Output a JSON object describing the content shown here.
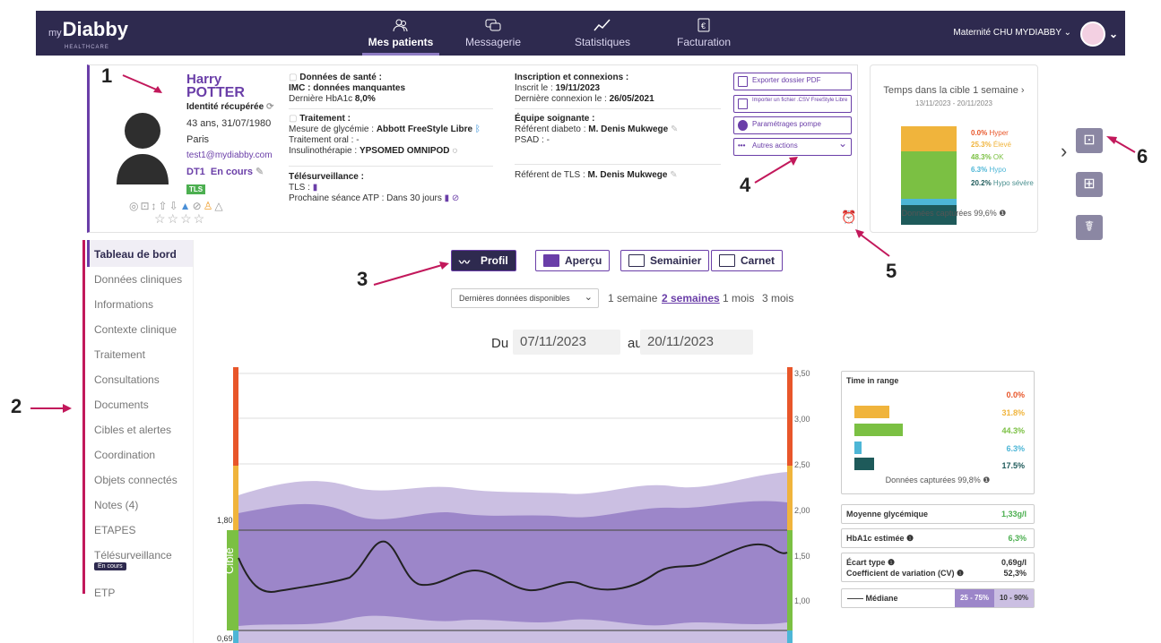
{
  "app": {
    "logo_prefix": "my",
    "logo": "Diabby",
    "logo_sub": "HEALTHCARE"
  },
  "nav": [
    {
      "label": "Mes patients",
      "icon": "patients-icon",
      "active": true
    },
    {
      "label": "Messagerie",
      "icon": "chat-icon"
    },
    {
      "label": "Statistiques",
      "icon": "stats-icon"
    },
    {
      "label": "Facturation",
      "icon": "billing-icon"
    }
  ],
  "establishment": "Maternité CHU MYDIABBY",
  "patient": {
    "first_name": "Harry",
    "last_name": "POTTER",
    "identity": "Identité récupérée",
    "age_dob": "43 ans, 31/07/1980",
    "city": "Paris",
    "email": "test1@mydiabby.com",
    "diabetes_type": "DT1",
    "status": "En cours",
    "tls_badge": "TLS"
  },
  "health": {
    "title": "Données de santé :",
    "line1": "IMC : données manquantes",
    "line2_label": "Dernière HbA1c ",
    "line2_value": "8,0%",
    "treatment_title": "Traitement :",
    "t1_label": "Mesure de glycémie : ",
    "t1_value": "Abbott FreeStyle Libre",
    "t2": "Traitement oral : -",
    "t3_label": "Insulinothérapie : ",
    "t3_value": "YPSOMED OMNIPOD",
    "telesurv_title": "Télésurveillance :",
    "telesurv_tls": "TLS :",
    "telesurv_next": "Prochaine séance ATP : Dans 30 jours"
  },
  "inscription": {
    "title": "Inscription et connexions :",
    "l1_label": "Inscrit le : ",
    "l1_value": "19/11/2023",
    "l2_label": "Dernière connexion le : ",
    "l2_value": "26/05/2021",
    "team_title": "Équipe soignante :",
    "team1_label": "Référent diabeto : ",
    "team1_value": "M. Denis Mukwege",
    "team2": "PSAD : -",
    "tls_ref_label": "Référent de TLS : ",
    "tls_ref_value": "M. Denis Mukwege"
  },
  "actions": {
    "export": "Exporter dossier PDF",
    "import": "Importer un fichier .CSV FreeStyle Libre",
    "pump": "Paramétrages pompe",
    "more": "Autres actions"
  },
  "tir_summary": {
    "title": "Temps dans la cible 1 semaine",
    "dates": "13/11/2023 - 20/11/2023",
    "rows": [
      {
        "value": "0.0%",
        "label": "Hyper",
        "color": "#e8562a",
        "frac": 0.0
      },
      {
        "value": "25.3%",
        "label": "Élevé",
        "color": "#f0b43c",
        "frac": 0.253
      },
      {
        "value": "48.3%",
        "label": "OK",
        "color": "#7bc043",
        "frac": 0.483
      },
      {
        "value": "6.3%",
        "label": "Hypo",
        "color": "#4db6d6",
        "frac": 0.063
      },
      {
        "value": "20.2%",
        "label": "Hypo sévère",
        "color": "#1e5a5a",
        "frac": 0.202
      }
    ],
    "captured": "Données capturées 99,6%"
  },
  "leftnav": [
    "Tableau de bord",
    "Données cliniques",
    "Informations",
    "Contexte clinique",
    "Traitement",
    "Consultations",
    "Documents",
    "Cibles et alertes",
    "Coordination",
    "Objets connectés",
    "Notes (4)",
    "ETAPES",
    "Télésurveillance",
    "ETP"
  ],
  "leftnav_badge": "En cours",
  "views": [
    "Profil",
    "Aperçu",
    "Semainier",
    "Carnet"
  ],
  "period": {
    "select": "Dernières données disponibles",
    "options": [
      "1 semaine",
      "2 semaines",
      "1 mois",
      "3 mois"
    ],
    "active": "2 semaines"
  },
  "dates": {
    "from_label": "Du",
    "from": "07/11/2023",
    "to_label": "au",
    "to": "20/11/2023"
  },
  "chart_data": {
    "type": "area",
    "y_right_ticks": [
      "3,50",
      "3,00",
      "2,50",
      "2,00",
      "1,50",
      "1,00"
    ],
    "y_left_labels": [
      "1,80",
      "0,69"
    ],
    "target_label": "Cible",
    "target_range": [
      0.69,
      1.8
    ],
    "ylim": [
      0.5,
      3.5
    ]
  },
  "stats": {
    "tir_title": "Time in range",
    "tir_values": [
      {
        "value": "0.0%",
        "color": "#e8562a",
        "frac": 0.0
      },
      {
        "value": "31.8%",
        "color": "#f0b43c",
        "frac": 0.318
      },
      {
        "value": "44.3%",
        "color": "#7bc043",
        "frac": 0.443
      },
      {
        "value": "6.3%",
        "color": "#4db6d6",
        "frac": 0.063
      },
      {
        "value": "17.5%",
        "color": "#1e5a5a",
        "frac": 0.175
      }
    ],
    "tir_captured": "Données capturées 99,8%",
    "mean_label": "Moyenne glycémique",
    "mean_value": "1,33g/l",
    "hba1c_label": "HbA1c estimée",
    "hba1c_value": "6,3%",
    "sd_label": "Écart type",
    "sd_value": "0,69g/l",
    "cv_label": "Coefficient de variation (CV)",
    "cv_value": "52,3%",
    "legend_median": "Médiane",
    "legend_25": "25 - 75%",
    "legend_10": "10 - 90%"
  },
  "annotations": [
    "1",
    "2",
    "3",
    "4",
    "5",
    "6"
  ]
}
